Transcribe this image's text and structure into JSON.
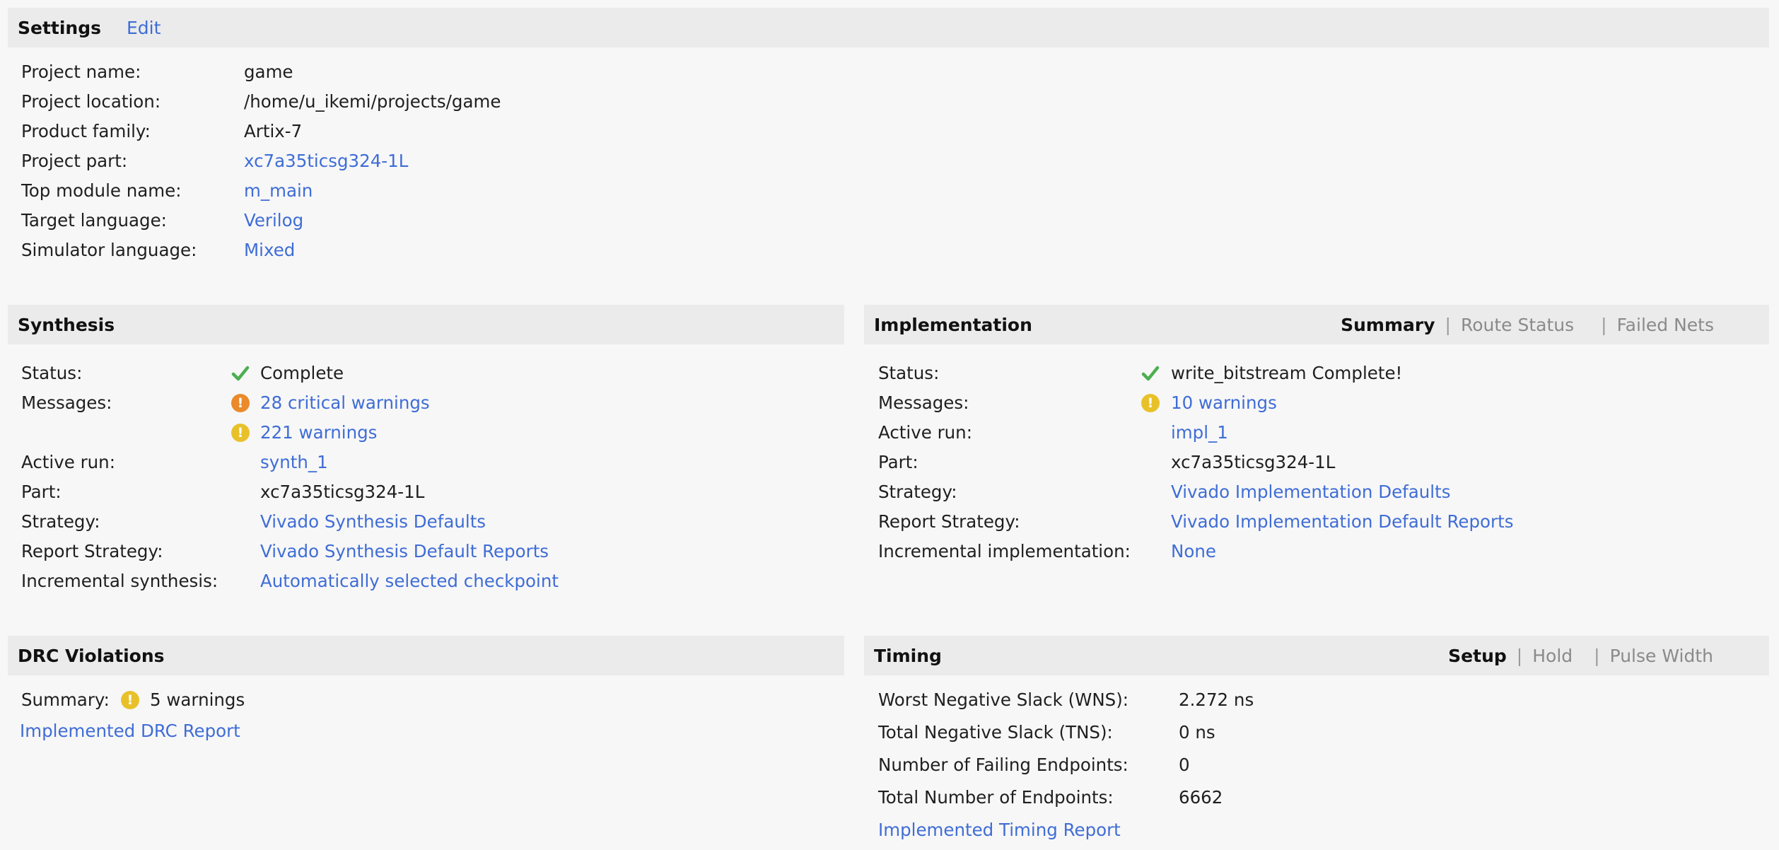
{
  "settings": {
    "title": "Settings",
    "edit_label": "Edit",
    "rows": [
      {
        "label": "Project name:",
        "value": "game",
        "link": false
      },
      {
        "label": "Project location:",
        "value": "/home/u_ikemi/projects/game",
        "link": false
      },
      {
        "label": "Product family:",
        "value": "Artix-7",
        "link": false
      },
      {
        "label": "Project part:",
        "value": "xc7a35ticsg324-1L",
        "link": true
      },
      {
        "label": "Top module name:",
        "value": "m_main",
        "link": true
      },
      {
        "label": "Target language:",
        "value": "Verilog",
        "link": true
      },
      {
        "label": "Simulator language:",
        "value": "Mixed",
        "link": true
      }
    ]
  },
  "synthesis": {
    "title": "Synthesis",
    "status_label": "Status:",
    "status_value": "Complete",
    "messages_label": "Messages:",
    "critical_warnings": "28 critical warnings",
    "warnings": "221 warnings",
    "active_run_label": "Active run:",
    "active_run": "synth_1",
    "part_label": "Part:",
    "part": "xc7a35ticsg324-1L",
    "strategy_label": "Strategy:",
    "strategy": "Vivado Synthesis Defaults",
    "report_strategy_label": "Report Strategy:",
    "report_strategy": "Vivado Synthesis Default Reports",
    "incremental_label": "Incremental synthesis:",
    "incremental": "Automatically selected checkpoint"
  },
  "implementation": {
    "title": "Implementation",
    "tabs": [
      "Summary",
      "Route Status",
      "Failed Nets"
    ],
    "status_label": "Status:",
    "status_value": "write_bitstream Complete!",
    "messages_label": "Messages:",
    "warnings": "10 warnings",
    "active_run_label": "Active run:",
    "active_run": "impl_1",
    "part_label": "Part:",
    "part": "xc7a35ticsg324-1L",
    "strategy_label": "Strategy:",
    "strategy": "Vivado Implementation Defaults",
    "report_strategy_label": "Report Strategy:",
    "report_strategy": "Vivado Implementation Default Reports",
    "incremental_label": "Incremental implementation:",
    "incremental": "None"
  },
  "drc": {
    "title": "DRC Violations",
    "summary_label": "Summary:",
    "summary_value": "5 warnings",
    "report_link": "Implemented DRC Report"
  },
  "timing": {
    "title": "Timing",
    "tabs": [
      "Setup",
      "Hold",
      "Pulse Width"
    ],
    "rows": [
      {
        "label": "Worst Negative Slack (WNS):",
        "value": "2.272 ns"
      },
      {
        "label": "Total Negative Slack (TNS):",
        "value": "0 ns"
      },
      {
        "label": "Number of Failing Endpoints:",
        "value": "0"
      },
      {
        "label": "Total Number of Endpoints:",
        "value": "6662"
      }
    ],
    "report_link": "Implemented Timing Report"
  },
  "colors": {
    "link": "#3f6dd6",
    "check": "#4caf50",
    "critical": "#ea8a2b",
    "warning": "#e8c12a",
    "header_bg": "#ebebeb"
  },
  "icons": {
    "status_ok": "check-icon",
    "critical_warning": "critical-warning-icon",
    "warning": "warning-icon"
  }
}
